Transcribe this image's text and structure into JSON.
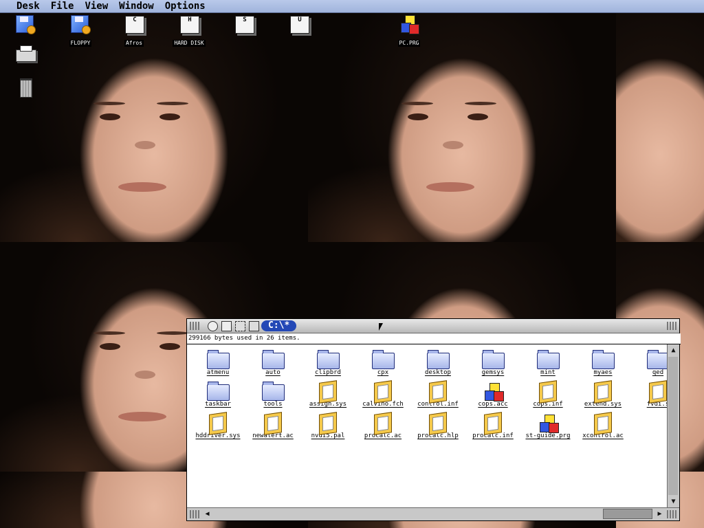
{
  "menubar": {
    "items": [
      "Desk",
      "File",
      "View",
      "Window",
      "Options"
    ]
  },
  "desktop_icons": [
    {
      "name": "floppy-a-icon",
      "label": ""
    },
    {
      "name": "floppy-b-icon",
      "label": "FLOPPY"
    },
    {
      "name": "drive-c-icon",
      "label": "Afros",
      "letter": "C"
    },
    {
      "name": "drive-h-icon",
      "label": "HARD DISK",
      "letter": "H"
    },
    {
      "name": "drive-s-icon",
      "label": "",
      "letter": "S"
    },
    {
      "name": "drive-u-icon",
      "label": "",
      "letter": "U"
    },
    {
      "name": "pc-prg-icon",
      "label": "PC.PRG"
    },
    {
      "name": "printer-icon",
      "label": ""
    },
    {
      "name": "trash-icon",
      "label": ""
    }
  ],
  "window": {
    "title": "C:\\*",
    "info": "299166 bytes used in 26 items.",
    "files": [
      {
        "label": "atmenu",
        "kind": "folder"
      },
      {
        "label": "auto",
        "kind": "folder"
      },
      {
        "label": "clipbrd",
        "kind": "folder"
      },
      {
        "label": "cpx",
        "kind": "folder"
      },
      {
        "label": "desktop",
        "kind": "folder"
      },
      {
        "label": "gemsys",
        "kind": "folder"
      },
      {
        "label": "mint",
        "kind": "folder"
      },
      {
        "label": "myaes",
        "kind": "folder"
      },
      {
        "label": "qed",
        "kind": "folder"
      },
      {
        "label": "taskbar",
        "kind": "folder"
      },
      {
        "label": "tools",
        "kind": "folder"
      },
      {
        "label": "assign.sys",
        "kind": "doc"
      },
      {
        "label": "calvino.fch",
        "kind": "doc"
      },
      {
        "label": "control.inf",
        "kind": "doc"
      },
      {
        "label": "cops.acc",
        "kind": "cubes"
      },
      {
        "label": "cops.inf",
        "kind": "doc"
      },
      {
        "label": "extend.sys",
        "kind": "doc"
      },
      {
        "label": "fvdi.s",
        "kind": "doc"
      },
      {
        "label": "hddriver.sys",
        "kind": "doc"
      },
      {
        "label": "newalert.ac",
        "kind": "doc"
      },
      {
        "label": "nvdi5.pal",
        "kind": "doc"
      },
      {
        "label": "procalc.ac",
        "kind": "doc"
      },
      {
        "label": "procalc.hlp",
        "kind": "doc"
      },
      {
        "label": "procalc.inf",
        "kind": "doc"
      },
      {
        "label": "st-guide.prg",
        "kind": "cubes"
      },
      {
        "label": "xcontrol.ac",
        "kind": "doc"
      }
    ]
  },
  "colors": {
    "menubar": "#a9bce3",
    "title_pill": "#2348b6",
    "folder": "#a7b6ea",
    "doc": "#f5c94a"
  }
}
